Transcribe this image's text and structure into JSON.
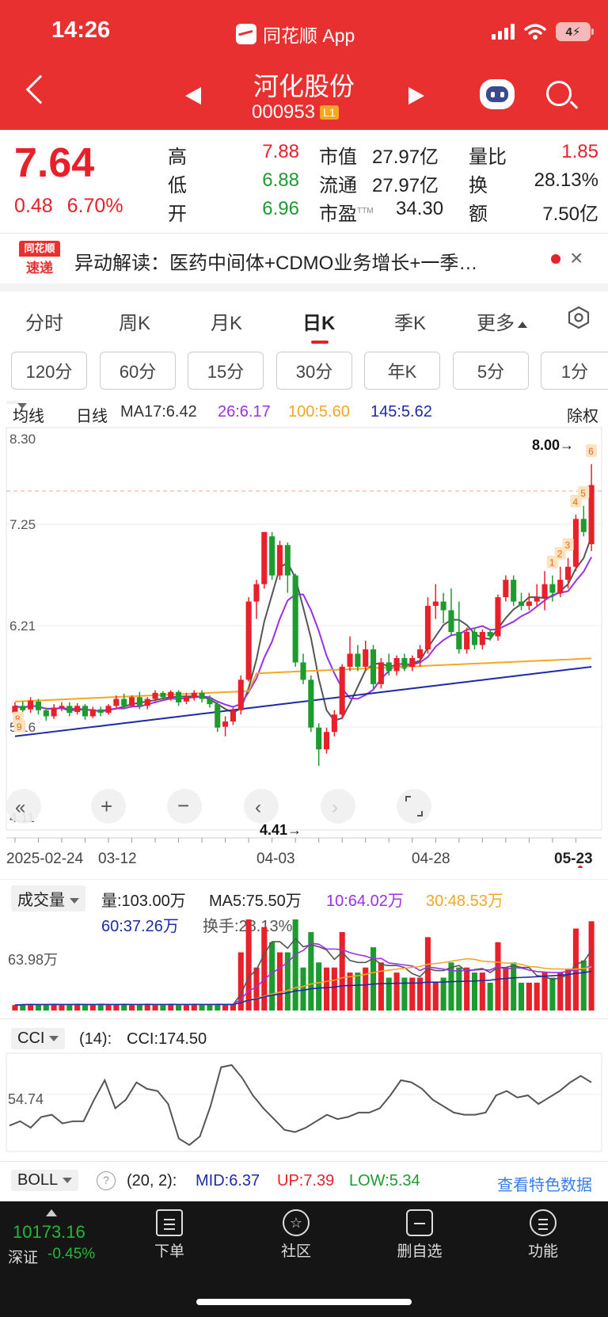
{
  "status": {
    "time": "14:26",
    "app_name": "同花顺 App",
    "battery": "4"
  },
  "header": {
    "stock_name": "河化股份",
    "stock_code": "000953",
    "level_badge": "L1"
  },
  "quote": {
    "price": "7.64",
    "change": "0.48",
    "change_pct": "6.70%",
    "high_label": "高",
    "high": "7.88",
    "low_label": "低",
    "low": "6.88",
    "open_label": "开",
    "open": "6.96",
    "mktcap_label": "市值",
    "mktcap": "27.97亿",
    "float_label": "流通",
    "float": "27.97亿",
    "pe_label": "市盈",
    "pe_sup": "TTM",
    "pe": "34.30",
    "volratio_label": "量比",
    "volratio": "1.85",
    "turnover_label": "换",
    "turnover": "28.13%",
    "amount_label": "额",
    "amount": "7.50亿"
  },
  "news": {
    "logo_top": "同花顺",
    "logo_bottom": "速递",
    "text": "异动解读：医药中间体+CDMO业务增长+一季…",
    "close": "×"
  },
  "tabs": [
    {
      "label": "分时"
    },
    {
      "label": "周K"
    },
    {
      "label": "月K"
    },
    {
      "label": "日K"
    },
    {
      "label": "季K"
    },
    {
      "label": "更多"
    }
  ],
  "periods": [
    "120分",
    "60分",
    "15分",
    "30分",
    "年K",
    "5分",
    "1分"
  ],
  "ma_row": {
    "selector": "均线",
    "kind": "日线",
    "ma17": "MA17:6.42",
    "ma26": "26:6.17",
    "ma100": "100:5.60",
    "ma145": "145:5.62",
    "adjust": "除权",
    "color_ma26": "#9b30e8",
    "color_ma100": "#f5a623",
    "color_ma145": "#1e2aa8"
  },
  "kline": {
    "y_labels": [
      "8.30",
      "7.25",
      "6.21",
      "5.16",
      "4.11"
    ],
    "high_mark": "8.00→",
    "low_mark": "4.41→",
    "dates": [
      "2025-02-24",
      "03-12",
      "04-03",
      "04-28",
      "05-23"
    ],
    "markers": [
      "1",
      "2",
      "3",
      "4",
      "5",
      "6",
      "8",
      "9"
    ]
  },
  "volume": {
    "selector": "成交量",
    "vol": "量:103.00万",
    "ma5": "MA5:75.50万",
    "ma10": "10:64.02万",
    "ma30": "30:48.53万",
    "ma60": "60:37.26万",
    "turnover": "换手:28.13%",
    "y_label": "63.98万"
  },
  "cci": {
    "selector": "CCI",
    "param": "(14):",
    "value": "CCI:174.50",
    "y_label": "54.74"
  },
  "boll": {
    "selector": "BOLL",
    "help": "?",
    "param": "(20, 2):",
    "mid": "MID:6.37",
    "up": "UP:7.39",
    "low": "LOW:5.34",
    "link": "查看特色数据"
  },
  "bottom": {
    "index_value": "10173.16",
    "index_name": "深证",
    "index_change": "-0.45%",
    "nav": [
      {
        "label": "下单"
      },
      {
        "label": "社区"
      },
      {
        "label": "删自选"
      },
      {
        "label": "功能"
      }
    ]
  },
  "chart_data": {
    "type": "candlestick",
    "candles": [
      [
        5.02,
        5.1,
        4.95,
        5.14
      ],
      [
        5.1,
        5.05,
        5.0,
        5.15
      ],
      [
        5.06,
        5.16,
        5.02,
        5.2
      ],
      [
        5.15,
        5.05,
        5.0,
        5.18
      ],
      [
        5.05,
        4.98,
        4.93,
        5.08
      ],
      [
        4.98,
        5.08,
        4.95,
        5.12
      ],
      [
        5.08,
        5.1,
        5.04,
        5.14
      ],
      [
        5.1,
        5.02,
        4.98,
        5.14
      ],
      [
        5.03,
        5.1,
        5.0,
        5.13
      ],
      [
        5.1,
        4.98,
        4.94,
        5.12
      ],
      [
        4.98,
        5.06,
        4.96,
        5.09
      ],
      [
        5.06,
        5.02,
        4.98,
        5.09
      ],
      [
        5.02,
        5.1,
        5.0,
        5.12
      ],
      [
        5.1,
        5.18,
        5.06,
        5.22
      ],
      [
        5.18,
        5.1,
        5.06,
        5.24
      ],
      [
        5.1,
        5.2,
        5.08,
        5.22
      ],
      [
        5.2,
        5.1,
        5.06,
        5.26
      ],
      [
        5.1,
        5.18,
        5.06,
        5.2
      ],
      [
        5.18,
        5.25,
        5.15,
        5.28
      ],
      [
        5.25,
        5.2,
        5.16,
        5.27
      ],
      [
        5.2,
        5.26,
        5.16,
        5.28
      ],
      [
        5.26,
        5.14,
        5.1,
        5.28
      ],
      [
        5.15,
        5.2,
        5.12,
        5.25
      ],
      [
        5.2,
        5.25,
        5.16,
        5.28
      ],
      [
        5.25,
        5.18,
        5.14,
        5.28
      ],
      [
        5.18,
        5.12,
        5.08,
        5.22
      ],
      [
        5.12,
        4.85,
        4.8,
        5.15
      ],
      [
        4.86,
        4.92,
        4.75,
        4.98
      ],
      [
        4.92,
        5.05,
        4.88,
        5.08
      ],
      [
        5.05,
        5.4,
        5.0,
        5.45
      ],
      [
        5.4,
        6.3,
        5.38,
        6.35
      ],
      [
        6.3,
        6.5,
        6.1,
        6.55
      ],
      [
        6.5,
        7.1,
        6.45,
        7.1
      ],
      [
        7.05,
        6.6,
        6.55,
        7.1
      ],
      [
        6.6,
        6.95,
        6.55,
        7.0
      ],
      [
        6.95,
        6.6,
        6.4,
        6.98
      ],
      [
        6.6,
        5.6,
        5.55,
        6.62
      ],
      [
        5.6,
        5.4,
        5.35,
        5.7
      ],
      [
        5.4,
        4.85,
        4.8,
        5.45
      ],
      [
        4.85,
        4.6,
        4.41,
        4.9
      ],
      [
        4.6,
        4.8,
        4.55,
        4.85
      ],
      [
        4.8,
        5.0,
        4.75,
        5.05
      ],
      [
        5.0,
        5.55,
        4.95,
        5.58
      ],
      [
        5.55,
        5.7,
        5.5,
        5.9
      ],
      [
        5.7,
        5.55,
        5.5,
        5.8
      ],
      [
        5.55,
        5.75,
        5.5,
        5.85
      ],
      [
        5.75,
        5.35,
        5.3,
        5.8
      ],
      [
        5.35,
        5.6,
        5.3,
        5.65
      ],
      [
        5.6,
        5.5,
        5.45,
        5.7
      ],
      [
        5.5,
        5.65,
        5.45,
        5.68
      ],
      [
        5.65,
        5.55,
        5.5,
        5.7
      ],
      [
        5.55,
        5.65,
        5.5,
        5.68
      ],
      [
        5.65,
        5.75,
        5.55,
        5.8
      ],
      [
        5.75,
        6.25,
        5.7,
        6.35
      ],
      [
        6.25,
        6.3,
        6.1,
        6.5
      ],
      [
        6.3,
        6.2,
        6.05,
        6.4
      ],
      [
        6.2,
        5.95,
        5.9,
        6.45
      ],
      [
        5.95,
        5.75,
        5.7,
        6.3
      ],
      [
        5.75,
        5.95,
        5.7,
        6.0
      ],
      [
        5.95,
        5.8,
        5.75,
        6.0
      ],
      [
        5.8,
        5.95,
        5.75,
        5.98
      ],
      [
        5.95,
        5.9,
        5.85,
        5.98
      ],
      [
        5.9,
        6.35,
        5.85,
        6.38
      ],
      [
        6.35,
        6.55,
        6.3,
        6.6
      ],
      [
        6.55,
        6.3,
        6.25,
        6.6
      ],
      [
        6.3,
        6.25,
        6.2,
        6.4
      ],
      [
        6.25,
        6.3,
        6.2,
        6.4
      ],
      [
        6.3,
        6.35,
        6.25,
        6.5
      ],
      [
        6.35,
        6.5,
        6.2,
        6.65
      ],
      [
        6.5,
        6.4,
        6.3,
        6.6
      ],
      [
        6.4,
        6.55,
        6.35,
        6.7
      ],
      [
        6.55,
        6.7,
        6.45,
        6.8
      ],
      [
        6.7,
        7.25,
        6.65,
        7.3
      ],
      [
        7.25,
        7.1,
        7.05,
        7.4
      ],
      [
        6.96,
        7.64,
        6.88,
        7.88
      ]
    ],
    "y_range": [
      4.11,
      8.3
    ]
  }
}
